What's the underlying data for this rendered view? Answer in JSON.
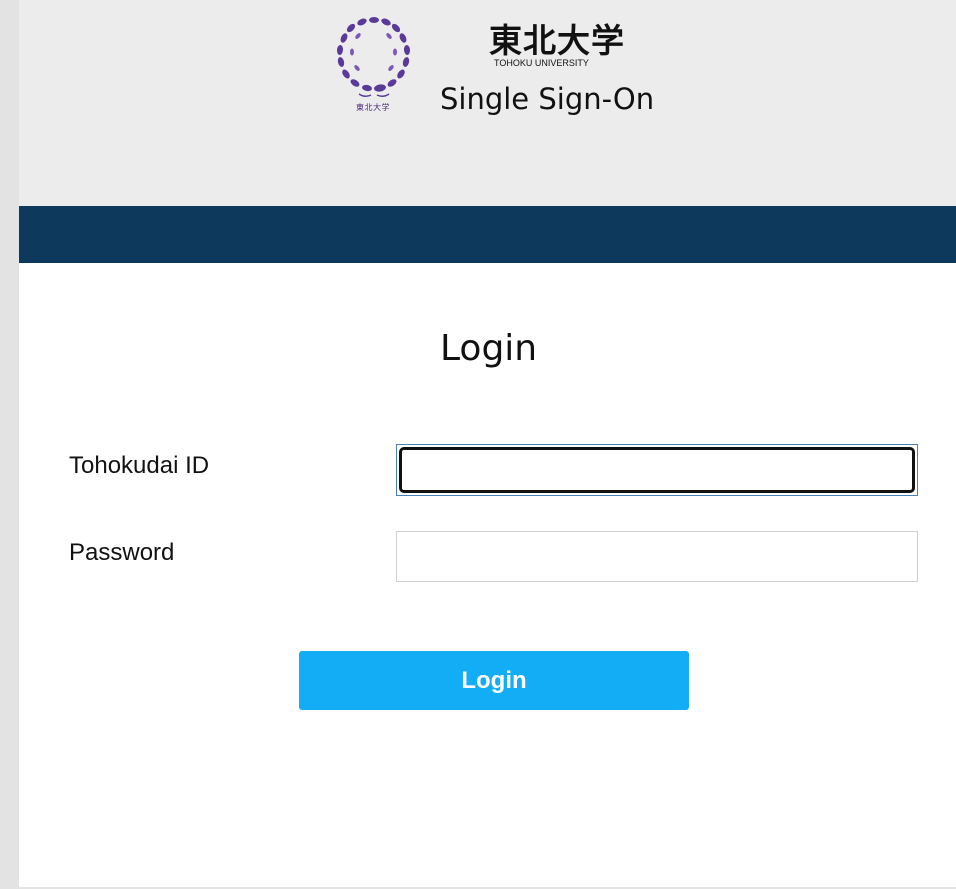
{
  "header": {
    "logo_icon": "tohoku-university-crest-icon",
    "logo_caption": "東北大学",
    "university_name_jp": "東北大学",
    "university_name_en": "TOHOKU UNIVERSITY",
    "title": "Single Sign-On"
  },
  "colors": {
    "header_background": "#ececec",
    "nav_band": "#0d3a5c",
    "login_button": "#13adf5",
    "crest_purple": "#5a3a99"
  },
  "form": {
    "heading": "Login",
    "id_label": "Tohokudai ID",
    "id_value": "",
    "password_label": "Password",
    "password_value": "",
    "submit_label": "Login"
  }
}
